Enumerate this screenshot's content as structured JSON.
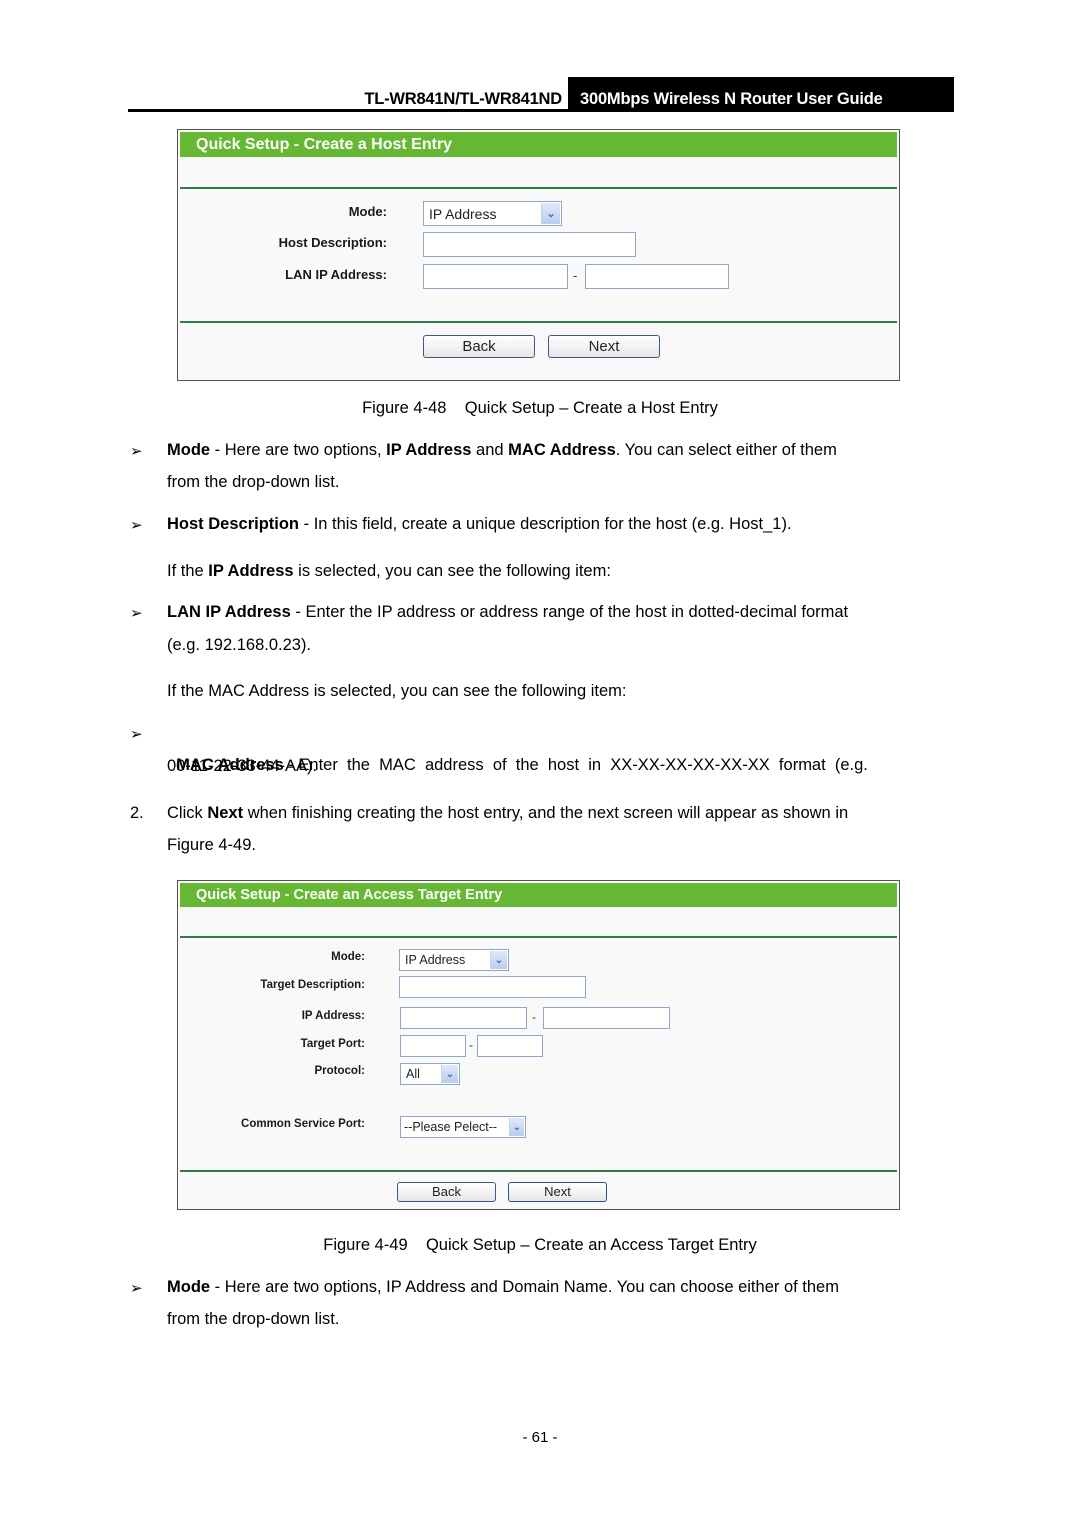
{
  "header": {
    "model": "TL-WR841N/TL-WR841ND",
    "guide_title": "300Mbps Wireless N Router User Guide"
  },
  "figure48": {
    "panel_title": "Quick Setup - Create a Host Entry",
    "mode_label": "Mode:",
    "mode_value": "IP Address",
    "host_desc_label": "Host Description:",
    "lan_ip_label": "LAN IP Address:",
    "range_separator": "-",
    "back_label": "Back",
    "next_label": "Next",
    "caption": "Figure 4-48    Quick Setup – Create a Host Entry"
  },
  "body1": {
    "bullet_glyph": "➢",
    "mode_bold": "Mode",
    "mode_text1": " - Here are two options, ",
    "mode_ip": "IP Address",
    "mode_and": " and ",
    "mode_mac": "MAC Address",
    "mode_text2": ". You can select either of them",
    "mode_line2": "from the drop-down list.",
    "hostdesc_bold": "Host Description",
    "hostdesc_text": " - In this field, create a unique description for the host (e.g. Host_1).",
    "ifip_pre": "If the ",
    "ifip_bold": "IP Address",
    "ifip_post": " is selected, you can see the following item:",
    "lanip_bold": "LAN IP Address",
    "lanip_text": " - Enter the IP address or address range of the host in dotted-decimal format",
    "lanip_line2": "(e.g. 192.168.0.23).",
    "ifmac": "If the MAC Address is selected, you can see the following item:",
    "mac_bold": "MAC Address",
    "mac_text": " - Enter  the  MAC  address  of  the  host  in  XX-XX-XX-XX-XX-XX  format  (e.g.",
    "mac_line2": "00-11-22-33-44-AA).",
    "step_num": "2.",
    "step_pre": "Click ",
    "step_bold": "Next",
    "step_text": " when finishing creating the host entry, and the next screen will appear as shown in",
    "step_line2": "Figure 4-49."
  },
  "figure49": {
    "panel_title": "Quick Setup - Create an Access Target Entry",
    "mode_label": "Mode:",
    "mode_value": "IP Address",
    "target_desc_label": "Target Description:",
    "ip_label": "IP Address:",
    "target_port_label": "Target Port:",
    "protocol_label": "Protocol:",
    "protocol_value": "All",
    "service_port_label": "Common Service Port:",
    "service_port_value": "--Please Pelect--",
    "range_separator": "-",
    "back_label": "Back",
    "next_label": "Next",
    "caption": "Figure 4-49    Quick Setup – Create an Access Target Entry"
  },
  "body2": {
    "mode_bold": "Mode",
    "mode_text": " - Here are two options, IP Address and Domain Name. You can choose either of them",
    "mode_line2": "from the drop-down list."
  },
  "footer": {
    "page_number": "- 61 -"
  }
}
